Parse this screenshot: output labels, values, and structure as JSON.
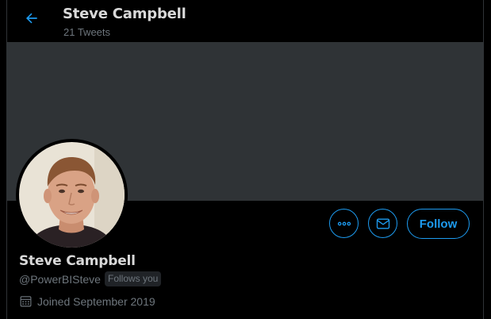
{
  "header": {
    "title": "Steve Campbell",
    "subtitle": "21 Tweets"
  },
  "actions": {
    "more_icon": "more-dots-icon",
    "message_icon": "envelope-icon",
    "follow_label": "Follow"
  },
  "profile": {
    "name": "Steve Campbell",
    "handle": "@PowerBISteve",
    "follows_you": "Follows you",
    "joined": "Joined September 2019"
  },
  "colors": {
    "accent": "#1d9bf0",
    "banner": "#2f3336",
    "background": "#000000",
    "muted_text": "#6e767d"
  }
}
